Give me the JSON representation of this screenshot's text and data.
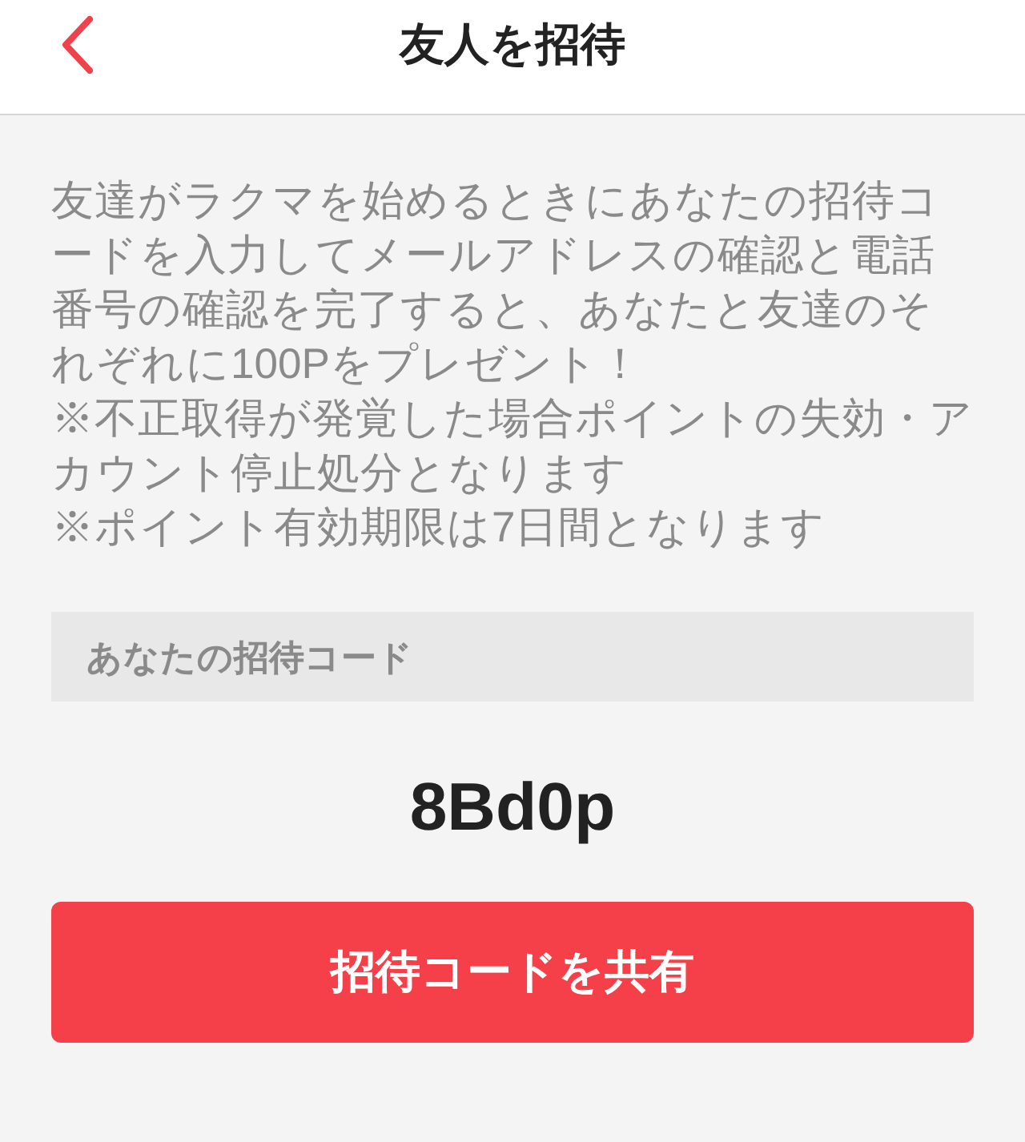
{
  "header": {
    "title": "友人を招待"
  },
  "description": [
    "友達がラクマを始めるときにあなたの招待コードを入力してメールアドレスの確認と電話番号の確認を完了すると、あなたと友達のそれぞれに100Pをプレゼント！",
    "※不正取得が発覚した場合ポイントの失効・アカウント停止処分となります",
    "※ポイント有効期限は7日間となります"
  ],
  "code_section": {
    "label": "あなたの招待コード",
    "code": "8Bd0p"
  },
  "share_button": {
    "label": "招待コードを共有"
  }
}
